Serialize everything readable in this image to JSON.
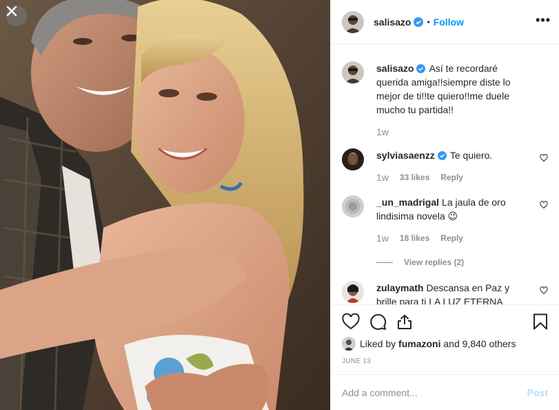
{
  "post": {
    "username": "salisazo",
    "follow_label": "Follow",
    "separator": "•",
    "more_label": "•••",
    "caption": "Así te recordaré querida amiga!!siempre diste lo mejor de ti!!te quiero!!me duele mucho tu partida!!",
    "caption_time": "1w"
  },
  "comments": [
    {
      "username": "sylviasaenzz",
      "verified": true,
      "text": "Te quiero.",
      "time": "1w",
      "likes": "33 likes",
      "reply_label": "Reply"
    },
    {
      "username": "_un_madrigal",
      "verified": false,
      "text": "La jaula de oro lindisima novela 😉",
      "time": "1w",
      "likes": "18 likes",
      "reply_label": "Reply",
      "view_replies": "View replies (2)"
    },
    {
      "username": "zulaymath",
      "verified": false,
      "text": "Descansa en Paz y brille para ti LA LUZ ETERNA"
    }
  ],
  "likes": {
    "prefix": "Liked by",
    "user": "fumazoni",
    "suffix": "and 9,840 others"
  },
  "date": "JUNE 13",
  "add_comment": {
    "placeholder": "Add a comment...",
    "post_label": "Post"
  },
  "colors": {
    "accent": "#0095f6",
    "verified": "#3897f0",
    "post_disabled": "#b2dffc"
  },
  "icons": [
    "close-icon",
    "verified-icon",
    "heart-icon",
    "comment-icon",
    "share-icon",
    "bookmark-icon"
  ]
}
